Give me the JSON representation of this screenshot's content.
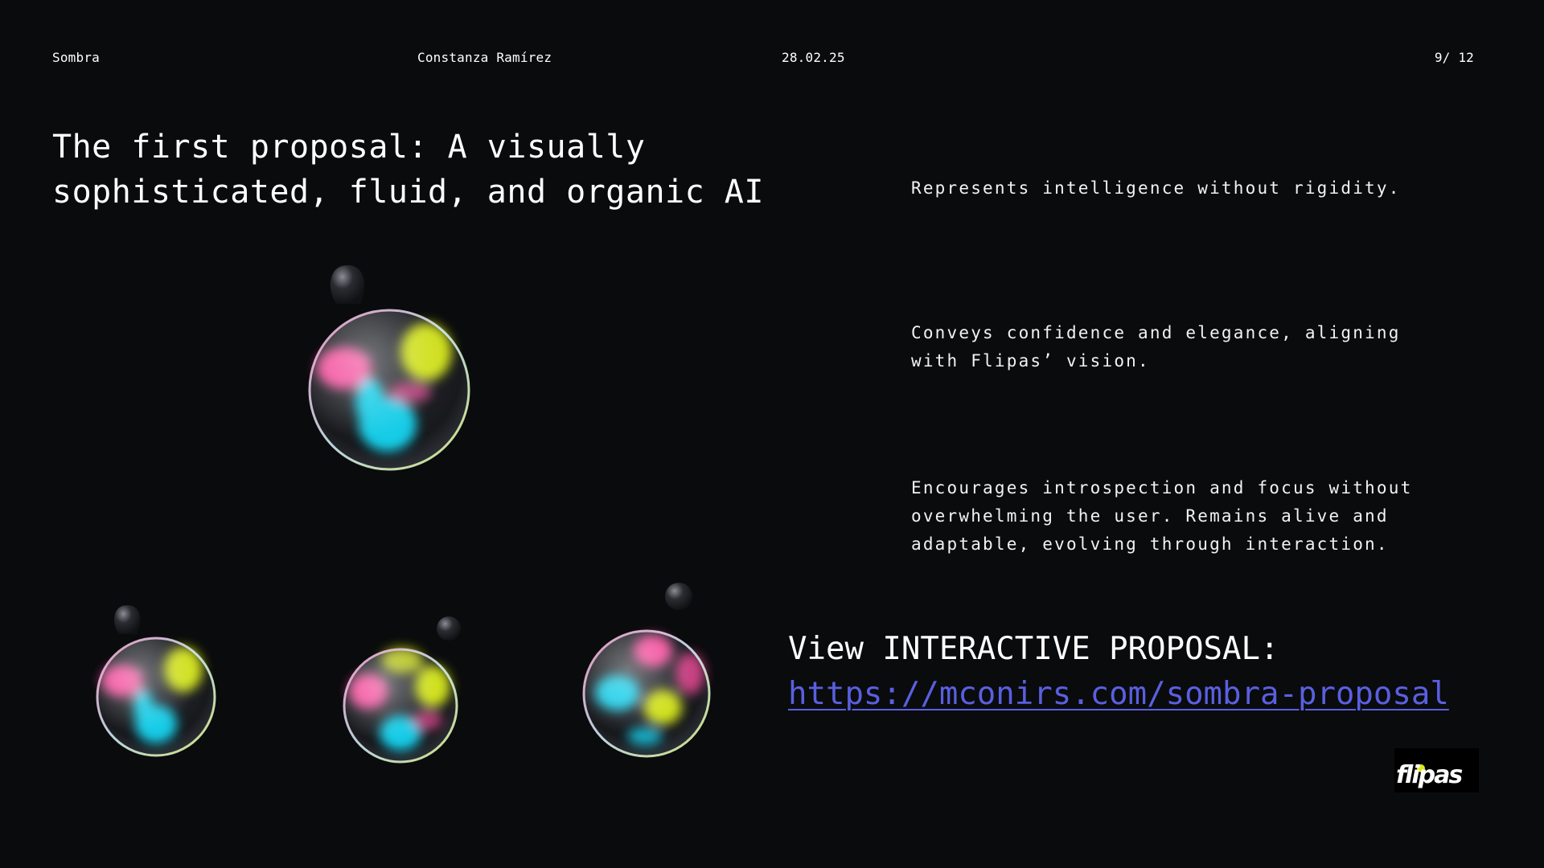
{
  "header": {
    "brand": "Sombra",
    "author": "Constanza Ramírez",
    "date": "28.02.25",
    "page": "9/ 12"
  },
  "title": "The first proposal: A visually sophisticated, fluid, and organic AI",
  "points": [
    "Represents intelligence without rigidity.",
    "Conveys confidence and elegance, aligning with Flipas’ vision.",
    "Encourages introspection and focus without overwhelming the user. Remains alive and adaptable, evolving through interaction."
  ],
  "cta": {
    "label": "View INTERACTIVE PROPOSAL:",
    "url": "https://mconirs.com/sombra-proposal"
  },
  "logo": {
    "text": "flipas"
  },
  "colors": {
    "background": "#0a0b0d",
    "link": "#5a5fe0",
    "pink": "#ff4fa3",
    "cyan": "#19d6f2",
    "lime": "#d9ea1b"
  }
}
